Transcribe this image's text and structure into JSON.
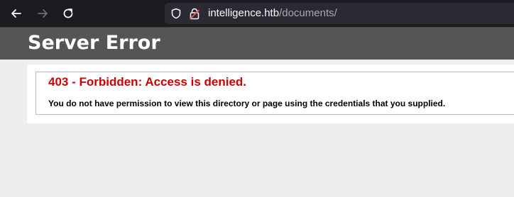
{
  "browser": {
    "url_host": "intelligence.htb",
    "url_path": "/documents/",
    "icons": [
      "back-icon",
      "forward-icon",
      "reload-icon",
      "shield-icon",
      "insecure-lock-icon"
    ]
  },
  "page": {
    "header_title": "Server Error",
    "error_title": "403 - Forbidden: Access is denied.",
    "error_message": "You do not have permission to view this directory or page using the credentials that you supplied."
  },
  "colors": {
    "toolbar_bg": "#1c1b22",
    "urlbar_bg": "#2b2a33",
    "header_bg": "#555555",
    "error_red": "#cc0000",
    "page_bg": "#eeeeee"
  }
}
